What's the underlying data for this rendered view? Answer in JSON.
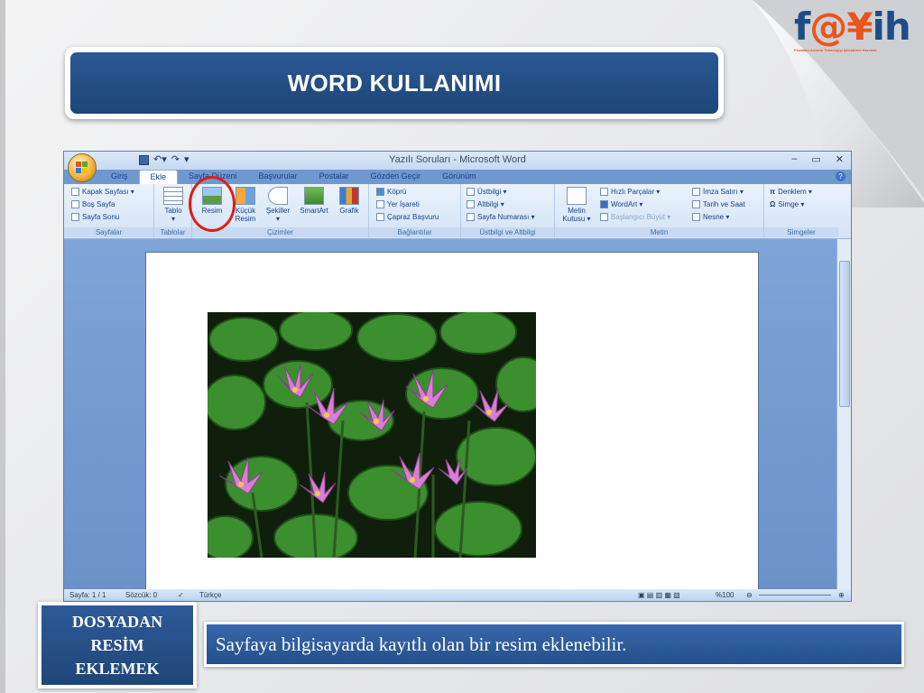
{
  "slide": {
    "title": "WORD KULLANIMI",
    "side_label": [
      "DOSYADAN",
      "RESİM",
      "EKLEMEK"
    ],
    "caption": "Sayfaya bilgisayarda kayıtlı olan bir resim eklenebilir.",
    "logo": {
      "text_f": "f",
      "text_at": "@",
      "text_rest": "ih",
      "sub": "Fırsatları Artırma Teknolojiyi İyileştirme Hareketi"
    }
  },
  "word": {
    "window_title": "Yazılı Soruları - Microsoft Word",
    "tabs": [
      "Giriş",
      "Ekle",
      "Sayfa Düzeni",
      "Başvurular",
      "Postalar",
      "Gözden Geçir",
      "Görünüm"
    ],
    "active_tab": "Ekle",
    "groups": {
      "sayfalar": {
        "label": "Sayfalar",
        "items": [
          "Kapak Sayfası ▾",
          "Boş Sayfa",
          "Sayfa Sonu"
        ]
      },
      "tablolar": {
        "label": "Tablolar",
        "items": [
          "Tablo"
        ]
      },
      "cizimler": {
        "label": "Çizimler",
        "items": [
          "Resim",
          "Küçük Resim",
          "Şekiller",
          "SmartArt",
          "Grafik"
        ]
      },
      "baglantilar": {
        "label": "Bağlantılar",
        "items": [
          "Köprü",
          "Yer İşareti",
          "Çapraz Başvuru"
        ]
      },
      "ustbilgi": {
        "label": "Üstbilgi ve Altbilgi",
        "items": [
          "Üstbilgi ▾",
          "Altbilgi ▾",
          "Sayfa Numarası ▾"
        ]
      },
      "metin": {
        "label": "Metin",
        "items": [
          "Metin Kutusu ▾",
          "Hızlı Parçalar ▾",
          "WordArt ▾",
          "Başlangıcı Büyüt ▾",
          "İmza Satırı ▾",
          "Tarih ve Saat",
          "Nesne ▾"
        ]
      },
      "simgeler": {
        "label": "Simgeler",
        "items": [
          "Denklem ▾",
          "Simge ▾"
        ]
      }
    },
    "status": {
      "page": "Sayfa: 1 / 1",
      "words": "Sözcük: 0",
      "language": "Türkçe",
      "zoom": "%100"
    }
  }
}
